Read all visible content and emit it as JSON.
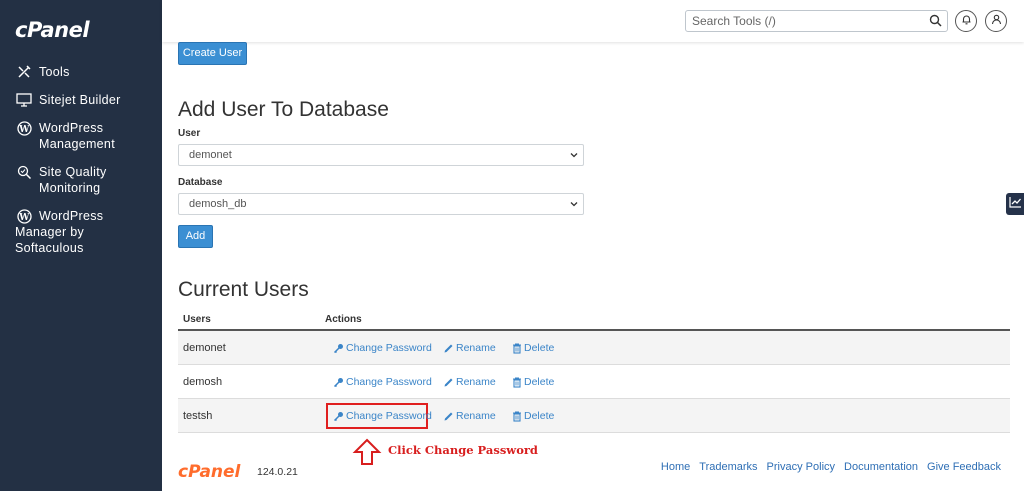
{
  "brand": {
    "logo": "cPanel",
    "version": "124.0.21",
    "accent": "#ff6c2c"
  },
  "sidebar": {
    "items": [
      {
        "label": "Tools",
        "icon": "tools-icon"
      },
      {
        "label": "Sitejet Builder",
        "icon": "monitor-icon"
      },
      {
        "label": "WordPress Management",
        "icon": "wordpress-icon"
      },
      {
        "label": "Site Quality Monitoring",
        "icon": "magnify-check-icon"
      },
      {
        "label": "WordPress Manager by Softaculous",
        "icon": "wordpress-icon"
      }
    ]
  },
  "topbar": {
    "search_placeholder": "Search Tools (/)",
    "notification_icon": "bell-icon",
    "user_icon": "user-icon"
  },
  "main": {
    "create_user_label": "Create User",
    "add_user_title": "Add User To Database",
    "user_label": "User",
    "user_selected": "demonet",
    "database_label": "Database",
    "database_selected": "demosh_db",
    "add_label": "Add",
    "current_users_title": "Current Users",
    "table": {
      "headers": [
        "Users",
        "Actions"
      ],
      "rows": [
        {
          "user": "demonet"
        },
        {
          "user": "demosh"
        },
        {
          "user": "testsh"
        }
      ],
      "actions": {
        "change_password": "Change Password",
        "rename": "Rename",
        "delete": "Delete"
      }
    }
  },
  "annotation": {
    "text": "Click Change Password",
    "color": "#d81e1e"
  },
  "footer": {
    "links": [
      "Home",
      "Trademarks",
      "Privacy Policy",
      "Documentation",
      "Give Feedback"
    ]
  }
}
